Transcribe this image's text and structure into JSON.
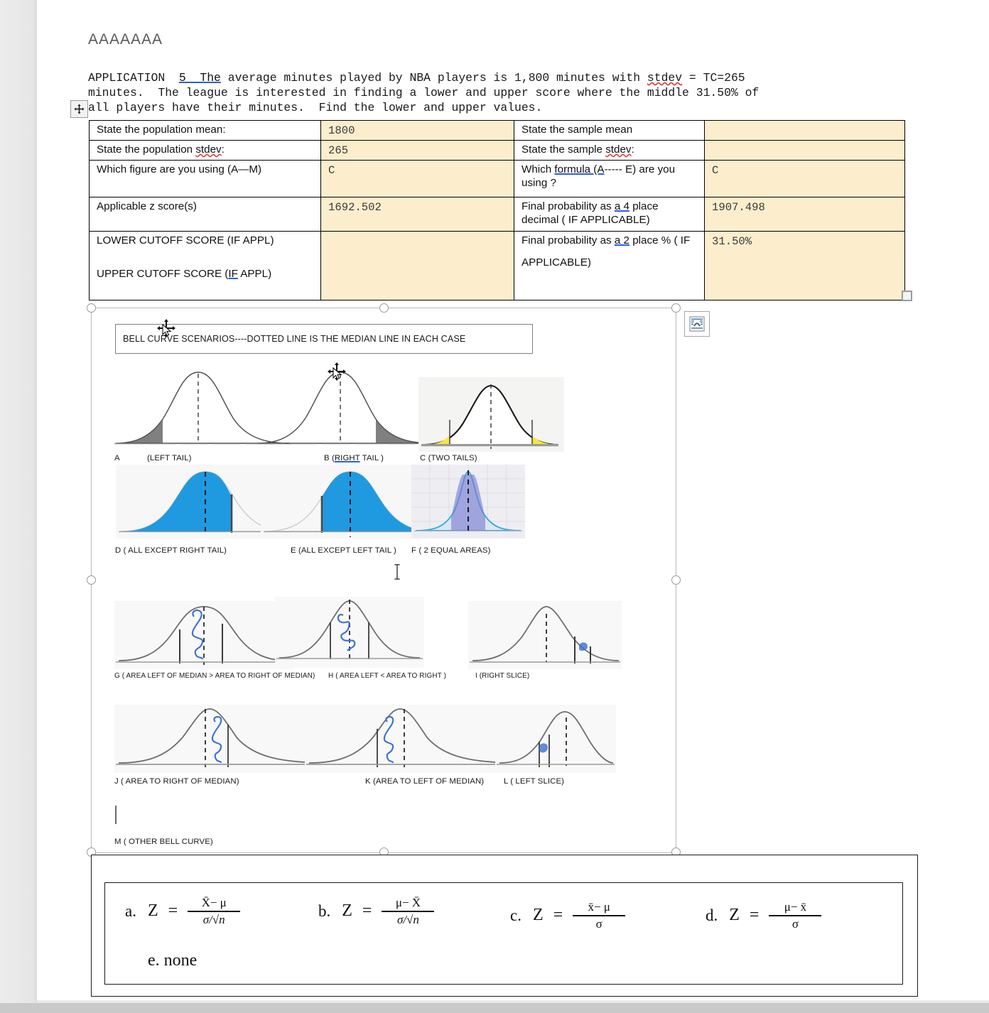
{
  "document": {
    "heading": "AAAAAAA",
    "paragraph": {
      "prefix": "APPLICATION  ",
      "underlined": "5  The",
      "rest_line1": " average minutes played by NBA players is 1,800 minutes with ",
      "spell_word": "stdev",
      "rest_line1b": " = TC=265",
      "line2": "minutes.  The league is interested in finding a lower and upper score where the middle 31.50% of",
      "line3": "all players have their minutes.  Find the lower and upper values."
    }
  },
  "worksheet_table": {
    "rows": [
      {
        "label_left": "State the population mean:",
        "value_left": "1800",
        "label_right": "State the sample mean",
        "value_right": ""
      },
      {
        "label_left": "State the population stdev:",
        "label_left_plain": "State the population ",
        "label_left_spell": "stdev",
        "label_left_tail": ":",
        "value_left": "265",
        "label_right_plain": "State the sample ",
        "label_right_spell": "stdev",
        "label_right_tail": ":",
        "value_right": ""
      },
      {
        "label_left": "Which figure are you using (A—M)",
        "value_left": "C",
        "label_right_a": "Which ",
        "label_right_link": "formula  (A",
        "label_right_b": "----- E)  are you using ?",
        "value_right": "C"
      },
      {
        "label_left": "Applicable z score(s)",
        "value_left": "1692.502",
        "label_right_a": "Final probability as ",
        "label_right_link": "a  4",
        "label_right_b": " place decimal ( IF APPLICABLE)",
        "value_right": "1907.498"
      },
      {
        "label_left_a": "LOWER CUTOFF SCORE (IF APPL)",
        "label_left_b_pre": "UPPER CUTOFF SCORE (",
        "label_left_b_link": "IF",
        "label_left_b_post": " APPL)",
        "value_left": "",
        "label_right_a": "Final probability as ",
        "label_right_link": "a  2",
        "label_right_b": " place % ( IF",
        "label_right_c": "APPLICABLE)",
        "value_right": "31.50%"
      }
    ]
  },
  "picture": {
    "banner": "BELL CURVE SCENARIOS----DOTTED LINE IS THE MEDIAN LINE IN EACH CASE",
    "captions": {
      "a": "A",
      "a_desc": "(LEFT TAIL)",
      "b_pre": "B (",
      "b_link": "RIGHT",
      "b_post": " TAIL )",
      "c": "C  (TWO TAILS)",
      "d": "D  ( ALL EXCEPT RIGHT TAIL)",
      "e": "E (ALL EXCEPT LEFT TAIL )",
      "f": "F ( 2 EQUAL AREAS)",
      "g": "G ( AREA LEFT OF MEDIAN > AREA TO RIGHT OF MEDIAN)",
      "h": "H ( AREA LEFT  < AREA TO RIGHT )",
      "i": "I  (RIGHT SLICE)",
      "j": "J ( AREA TO RIGHT OF MEDIAN)",
      "k": "K (AREA TO LEFT OF MEDIAN)",
      "l": "L  ( LEFT SLICE)",
      "m": "M ( OTHER BELL CURVE)"
    }
  },
  "formula_box": {
    "options": [
      {
        "letter": "a.",
        "z": "Z",
        "eq": "=",
        "numerator": "X̄−  μ",
        "denominator": "σ/√n"
      },
      {
        "letter": "b.",
        "z": "Z",
        "eq": "=",
        "numerator": "μ− X̄",
        "denominator": "σ/√n"
      },
      {
        "letter": "c.",
        "z": "Z",
        "eq": "=",
        "numerator": "x̄−  μ",
        "denominator": "σ"
      },
      {
        "letter": "d.",
        "z": "Z",
        "eq": "=",
        "numerator": "μ− x̄",
        "denominator": "σ"
      }
    ],
    "none_option": "e. none"
  },
  "colors": {
    "table_fill": "#fceecd",
    "table_border": "#000000",
    "link_underline": "#2b5fd9",
    "spell_underline": "#e03131",
    "curve_blue": "#1f9ae0",
    "curve_yellow": "#f5e642",
    "heading_gray": "#595959"
  },
  "icons": {
    "table_move": "table-move-handle",
    "table_resize": "table-resize-handle",
    "layout_options": "layout-options-icon"
  }
}
